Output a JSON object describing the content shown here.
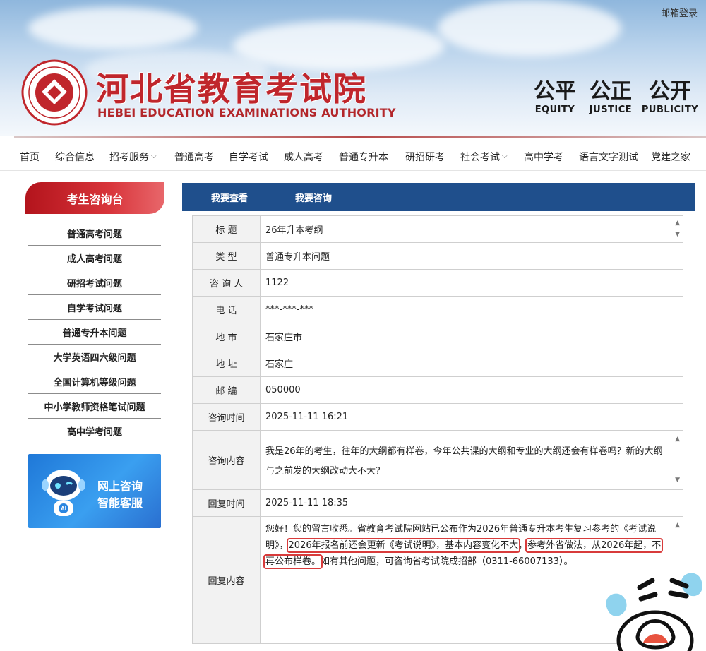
{
  "header": {
    "mailbox_login": "邮箱登录",
    "site_name_cn": "河北省教育考试院",
    "site_name_en": "HEBEI EDUCATION EXAMINATIONS AUTHORITY",
    "mottos": [
      {
        "cn": "公平",
        "en": "EQUITY"
      },
      {
        "cn": "公正",
        "en": "JUSTICE"
      },
      {
        "cn": "公开",
        "en": "PUBLICITY"
      }
    ]
  },
  "nav": {
    "items": [
      {
        "label": "首页",
        "has_dropdown": false
      },
      {
        "label": "综合信息",
        "has_dropdown": false
      },
      {
        "label": "招考服务",
        "has_dropdown": true
      },
      {
        "label": "普通高考",
        "has_dropdown": false
      },
      {
        "label": "自学考试",
        "has_dropdown": false
      },
      {
        "label": "成人高考",
        "has_dropdown": false
      },
      {
        "label": "普通专升本",
        "has_dropdown": false
      },
      {
        "label": "研招研考",
        "has_dropdown": false
      },
      {
        "label": "社会考试",
        "has_dropdown": true
      },
      {
        "label": "高中学考",
        "has_dropdown": false
      },
      {
        "label": "语言文字测试",
        "has_dropdown": false
      },
      {
        "label": "党建之家",
        "has_dropdown": false
      }
    ]
  },
  "sidebar": {
    "title": "考生咨询台",
    "items": [
      "普通高考问题",
      "成人高考问题",
      "研招考试问题",
      "自学考试问题",
      "普通专升本问题",
      "大学英语四六级问题",
      "全国计算机等级问题",
      "中小学教师资格笔试问题",
      "高中学考问题"
    ],
    "banner": {
      "title": "网上咨询",
      "subtitle": "智能客服",
      "robot_badge": "AI"
    }
  },
  "main": {
    "tabs": [
      "我要查看",
      "我要咨询"
    ],
    "rows": {
      "title": {
        "label": "标 题",
        "value": "26年升本考纲"
      },
      "type": {
        "label": "类 型",
        "value": "普通专升本问题"
      },
      "inquirer": {
        "label": "咨 询 人",
        "value": "1122"
      },
      "phone": {
        "label": "电 话",
        "value": "***-***-***"
      },
      "city": {
        "label": "地 市",
        "value": "石家庄市"
      },
      "address": {
        "label": "地 址",
        "value": "石家庄"
      },
      "postcode": {
        "label": "邮 编",
        "value": "050000"
      },
      "inquiry_time": {
        "label": "咨询时间",
        "value": "2025-11-11 16:21"
      },
      "inquiry_content": {
        "label": "咨询内容",
        "value": "我是26年的考生，往年的大纲都有样卷，今年公共课的大纲和专业的大纲还会有样卷吗？新的大纲与之前发的大纲改动大不大？"
      },
      "reply_time": {
        "label": "回复时间",
        "value": "2025-11-11 18:35"
      },
      "reply_content": {
        "label": "回复内容",
        "part1": "您好！您的留言收悉。省教育考试院网站已公布作为2026年普通专升本考生复习参考的《考试说明》，",
        "highlight1": "2026年报名前还会更新《考试说明》，基本内容变化不大",
        "sep": "，",
        "highlight2": "参考外省做法，从2026年起，不再公布样卷。",
        "part2": "如有其他问题，可咨询省考试院成招部（0311-66007133）。"
      }
    }
  },
  "colors": {
    "brand_red": "#c0262c",
    "tab_bar_blue": "#1f4f8c",
    "highlight_box": "#d83b3b",
    "banner_blue": "#2a86e0"
  }
}
